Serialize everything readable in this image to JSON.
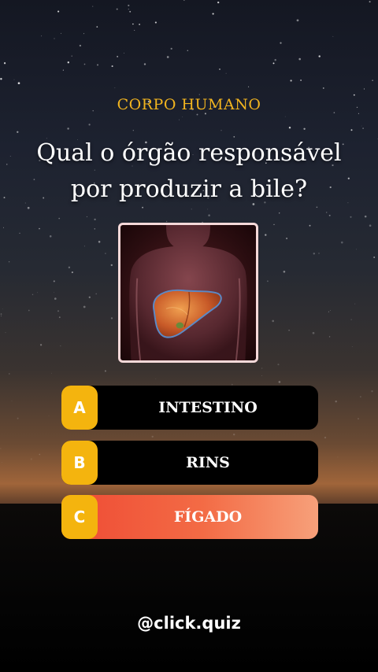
{
  "quiz": {
    "category": "CORPO HUMANO",
    "question_line1": "Qual o órgão responsável",
    "question_line2": "por produzir a bile?",
    "image_icon": "liver-anatomy-icon",
    "options": [
      {
        "letter": "A",
        "label": "INTESTINO",
        "correct": false
      },
      {
        "letter": "B",
        "label": "RINS",
        "correct": false
      },
      {
        "letter": "C",
        "label": "FÍGADO",
        "correct": true
      }
    ]
  },
  "footer": {
    "handle": "@click.quiz"
  },
  "colors": {
    "accent": "#f1b41f",
    "letter_badge": "#f4b40e",
    "correct_start": "#ef4a34",
    "correct_end": "#f7a07a",
    "option_bg": "#000000"
  }
}
